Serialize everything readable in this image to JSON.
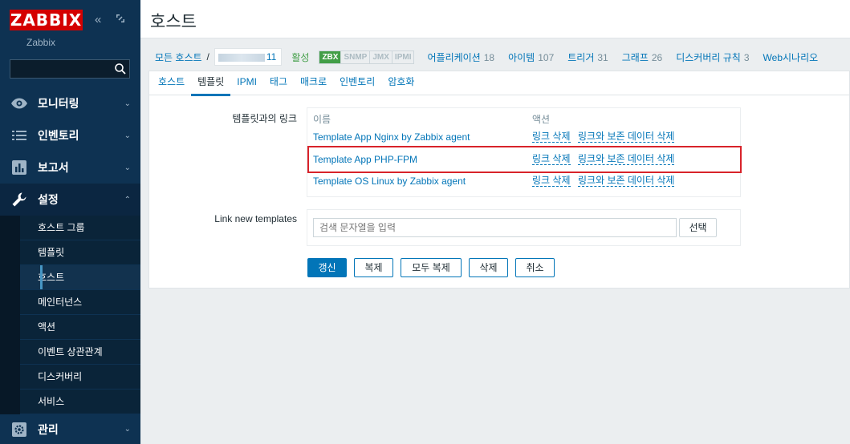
{
  "brand": {
    "logo": "ZABBIX",
    "server_name": "Zabbix"
  },
  "sidebar": {
    "search_placeholder": "",
    "menu": [
      {
        "label": "모니터링",
        "icon": "eye-icon"
      },
      {
        "label": "인벤토리",
        "icon": "list-icon"
      },
      {
        "label": "보고서",
        "icon": "bar-chart-icon"
      },
      {
        "label": "설정",
        "icon": "wrench-icon"
      },
      {
        "label": "관리",
        "icon": "gear-icon"
      }
    ],
    "config_submenu": [
      "호스트 그룹",
      "템플릿",
      "호스트",
      "메인터넌스",
      "액션",
      "이벤트 상관관계",
      "디스커버리",
      "서비스"
    ]
  },
  "header": {
    "title": "호스트"
  },
  "host_nav": {
    "all_hosts": "모든 호스트",
    "host_name_suffix": "11",
    "status": "활성",
    "availability": [
      "ZBX",
      "SNMP",
      "JMX",
      "IPMI"
    ],
    "links": [
      {
        "label": "어플리케이션",
        "count": "18"
      },
      {
        "label": "아이템",
        "count": "107"
      },
      {
        "label": "트리거",
        "count": "31"
      },
      {
        "label": "그래프",
        "count": "26"
      },
      {
        "label": "디스커버리 규칙",
        "count": "3"
      },
      {
        "label": "Web시나리오",
        "count": ""
      }
    ]
  },
  "tabs": [
    "호스트",
    "템플릿",
    "IPMI",
    "태그",
    "매크로",
    "인벤토리",
    "암호화"
  ],
  "form": {
    "linked_label": "템플릿과의 링크",
    "col_name": "이름",
    "col_action": "액션",
    "linked_templates": [
      {
        "name": "Template App Nginx by Zabbix agent",
        "unlink": "링크 삭제",
        "unlink_clear": "링크와 보존 데이터 삭제"
      },
      {
        "name": "Template App PHP-FPM",
        "unlink": "링크 삭제",
        "unlink_clear": "링크와 보존 데이터 삭제"
      },
      {
        "name": "Template OS Linux by Zabbix agent",
        "unlink": "링크 삭제",
        "unlink_clear": "링크와 보존 데이터 삭제"
      }
    ],
    "new_label": "Link new templates",
    "new_placeholder": "검색 문자열을 입력",
    "select_button": "선택"
  },
  "buttons": {
    "update": "갱신",
    "clone": "복제",
    "full_clone": "모두 복제",
    "delete": "삭제",
    "cancel": "취소"
  },
  "colors": {
    "sidebar": "#0e3252",
    "accent": "#0275b8",
    "brand": "#d40000",
    "highlight": "#d8232a",
    "enabled": "#429e47"
  }
}
